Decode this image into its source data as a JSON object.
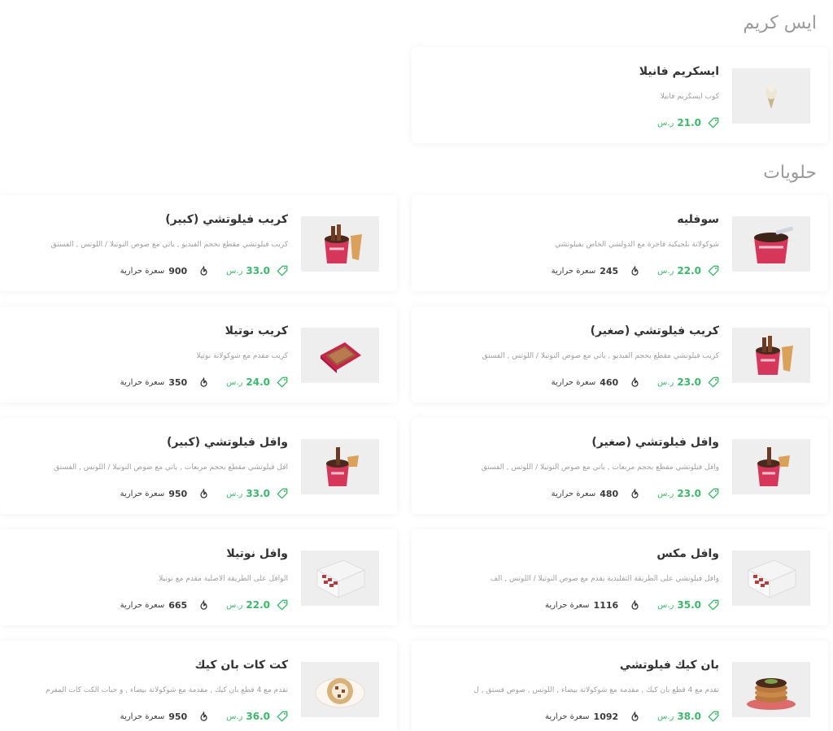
{
  "sections": [
    {
      "title": "ايس كريم",
      "items": [
        {
          "name": "ايسكريم فانيلا",
          "desc": "كوب ايسكريم فانيلا",
          "price": "21.0",
          "currency": "ر.س",
          "calories": "",
          "calories_label": "",
          "image": "ice-cream-cone"
        }
      ]
    },
    {
      "title": "حلويات",
      "items": [
        {
          "name": "سوفليه",
          "desc": "شوكولاتة بلجيكية فاخرة مع الدولشي الخاص بفيلوتشي",
          "price": "22.0",
          "currency": "ر.س",
          "calories": "245",
          "calories_label": "سعرة حرارية",
          "image": "souffle-cup"
        },
        {
          "name": "كريب فيلوتشي (كبير)",
          "desc": "كريب فيلوتشي مقطع بحجم الفيديو , يأتي مع صوص النوتيلا / اللوتس , الفستق",
          "price": "33.0",
          "currency": "ر.س",
          "calories": "900",
          "calories_label": "سعرة حرارية",
          "image": "crepe-cup"
        },
        {
          "name": "كريب فيلوتشي (صغير)",
          "desc": "كريب فيلوتشي مقطع بحجم الفيديو , يأتي مع صوص النوتيلا / اللوتس , الفستق",
          "price": "23.0",
          "currency": "ر.س",
          "calories": "460",
          "calories_label": "سعرة حرارية",
          "image": "crepe-cup"
        },
        {
          "name": "كريب نوتيلا",
          "desc": "كريب مقدم مع شوكولاتة نوتيلا",
          "price": "24.0",
          "currency": "ر.س",
          "calories": "350",
          "calories_label": "سعرة حرارية",
          "image": "box-open"
        },
        {
          "name": "وافل فيلوتشي (صغير)",
          "desc": "وافل فيلوتشي مقطع بحجم مربعات , يأتي مع صوص النوتيلا / اللوتس , الفستق",
          "price": "23.0",
          "currency": "ر.س",
          "calories": "480",
          "calories_label": "سعرة حرارية",
          "image": "waffle-cup"
        },
        {
          "name": "وافل فيلوتشي (كبير)",
          "desc": "افل فيلوتشي مقطع بحجم مربعات , يأتي مع صوص النوتيلا / اللوتس , الفستق",
          "price": "33.0",
          "currency": "ر.س",
          "calories": "950",
          "calories_label": "سعرة حرارية",
          "image": "waffle-cup"
        },
        {
          "name": "وافل مكس",
          "desc": "وافل فيلوتشي على الطريقة التقليدية يقدم مع صوص النوتيلا / اللوتس , الف",
          "price": "35.0",
          "currency": "ر.س",
          "calories": "1116",
          "calories_label": "سعرة حرارية",
          "image": "waffle-box"
        },
        {
          "name": "وافل نوتيلا",
          "desc": "الوافل على الطريقة الأصلية مقدم مع نوتيلا",
          "price": "22.0",
          "currency": "ر.س",
          "calories": "665",
          "calories_label": "سعرة حرارية",
          "image": "waffle-box"
        },
        {
          "name": "بان كيك فيلوتشي",
          "desc": "تقدم مع 4 قطع بان كيك , مقدمة مع شوكولاتة بيضاء , اللوتس , صوص فستق , ل",
          "price": "38.0",
          "currency": "ر.س",
          "calories": "1092",
          "calories_label": "سعرة حرارية",
          "image": "pancake-stack"
        },
        {
          "name": "كت كات بان كيك",
          "desc": "تقدم مع 4 قطع بان كيك , مقدمة مع شوكولاتة بيضاء , و حبات الكت كات المقرم",
          "price": "36.0",
          "currency": "ر.س",
          "calories": "950",
          "calories_label": "سعرة حرارية",
          "image": "pancake-plate"
        }
      ]
    }
  ],
  "colors": {
    "price": "#3cb86a",
    "title": "#9a9a9a",
    "card_bg": "#ffffff",
    "image_bg": "#efeeee"
  },
  "icons": {
    "price": "tag-icon",
    "calories": "flame-icon"
  }
}
